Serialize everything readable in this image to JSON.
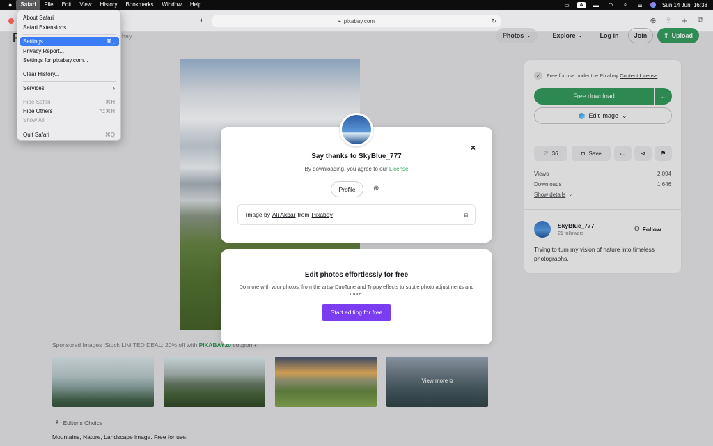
{
  "menubar": {
    "apple": "",
    "items": [
      "Safari",
      "File",
      "Edit",
      "View",
      "History",
      "Bookmarks",
      "Window",
      "Help"
    ],
    "clock": "Sun 14 Jun  16:38",
    "input_source": "A"
  },
  "safari_menu": {
    "about": "About Safari",
    "extensions": "Safari Extensions...",
    "settings": "Settings...",
    "settings_shortcut": "⌘ ,",
    "privacy": "Privacy Report...",
    "site_settings": "Settings for pixabay.com...",
    "clear_history": "Clear History...",
    "services": "Services",
    "hide_safari": "Hide Safari",
    "hide_safari_shortcut": "⌘H",
    "hide_others": "Hide Others",
    "hide_others_shortcut": "⌥⌘H",
    "show_all": "Show All",
    "quit": "Quit Safari",
    "quit_shortcut": "⌘Q"
  },
  "toolbar": {
    "url": "pixabay.com"
  },
  "site_nav": {
    "partial_text": "bay",
    "photos": "Photos",
    "explore": "Explore",
    "login": "Log in",
    "join": "Join",
    "upload": "Upload"
  },
  "panel": {
    "license_prefix": "Free for use under the Pixabay",
    "license_link": "Content License",
    "free_download": "Free download",
    "edit_image": "Edit image",
    "likes": "36",
    "save": "Save",
    "views_label": "Views",
    "views_value": "2,094",
    "downloads_label": "Downloads",
    "downloads_value": "1,646",
    "show_details": "Show details",
    "author": "SkyBlue_777",
    "followers": "21 followers",
    "follow": "Follow",
    "bio": "Trying to turn my vision of nature into timeless photographs."
  },
  "modal": {
    "title": "Say thanks to SkyBlue_777",
    "subtitle_prefix": "By downloading, you agree to our",
    "subtitle_link": "License",
    "profile": "Profile",
    "credit_prefix": "Image by",
    "credit_author": "Ali Akbar",
    "credit_mid": "from",
    "credit_site": "Pixabay"
  },
  "promo": {
    "title": "Edit photos effortlessly for free",
    "body": "Do more with your photos, from the artsy DuoTone and Trippy effects to subtle photo adjustments and more.",
    "cta": "Start editing for free"
  },
  "sponsored": {
    "prefix": "Sponsored Images iStock LIMITED DEAL: 20% off with",
    "code": "PIXABAY20",
    "suffix": "coupon",
    "view_more": "View more"
  },
  "editors_choice": "Editor's Choice",
  "description": "Mountains, Nature, Landscape image. Free for use.",
  "colors": {
    "accent_green": "#2ea15c",
    "menu_highlight": "#3b7df6",
    "promo_purple": "#7b3df0",
    "link_green": "#2ea15c"
  }
}
